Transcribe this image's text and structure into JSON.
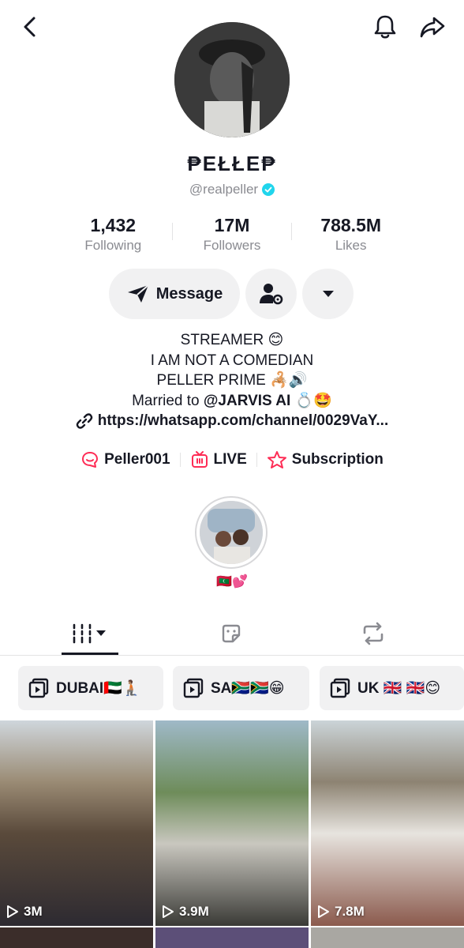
{
  "header": {
    "back_icon": "chevron-left-icon",
    "bell_icon": "bell-icon",
    "share_icon": "share-arrow-icon"
  },
  "profile": {
    "display_name": "₱ЕŁŁЕ₱",
    "handle": "@realpeller",
    "verified": true
  },
  "stats": {
    "following": {
      "value": "1,432",
      "label": "Following"
    },
    "followers": {
      "value": "17M",
      "label": "Followers"
    },
    "likes": {
      "value": "788.5M",
      "label": "Likes"
    }
  },
  "actions": {
    "message_label": "Message"
  },
  "bio": {
    "line1": "STREAMER 😊",
    "line2": "I AM NOT A COMEDIAN",
    "line3": "PELLER PRIME 🦂🔊",
    "line4_prefix": "Married to ",
    "line4_mention": "@JARVIS AI",
    "line4_suffix": " 💍🤩",
    "link": "https://whatsapp.com/channel/0029VaY..."
  },
  "links": {
    "group": "Peller001",
    "live": "LIVE",
    "subscription": "Subscription"
  },
  "highlight": {
    "label": "🇲🇻💕"
  },
  "tabs": [
    "videos",
    "favorites",
    "reposts"
  ],
  "playlists": [
    {
      "label": "DUBAI🇦🇪🧎🏽"
    },
    {
      "label": "SA🇿🇦🇿🇦😁"
    },
    {
      "label": "UK 🇬🇧 🇬🇧😊"
    }
  ],
  "videos": [
    {
      "views": "3M"
    },
    {
      "views": "3.9M"
    },
    {
      "views": "7.8M"
    }
  ],
  "colors": {
    "accent": "#fe2c55",
    "verified": "#20d5ec",
    "secondary_text": "#8a8b91",
    "button_bg": "#f1f1f2"
  }
}
